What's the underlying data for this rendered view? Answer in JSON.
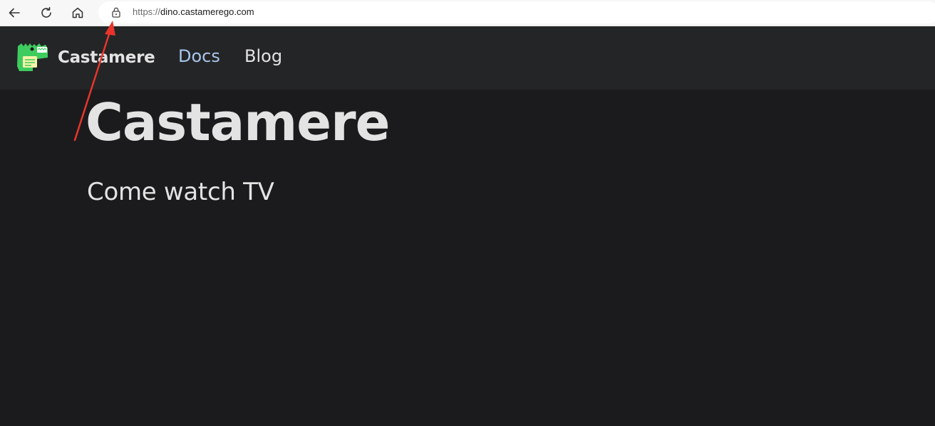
{
  "browser": {
    "url_scheme": "https://",
    "url_host": "dino.castamerego.com",
    "icons": [
      "back-arrow-icon",
      "reload-icon",
      "home-icon",
      "lock-icon"
    ]
  },
  "navbar": {
    "brand_title": "Castamere",
    "brand_logo_icon": "dinosaur-logo-icon",
    "links": [
      {
        "label": "Docs",
        "color": "#a9c6ee"
      },
      {
        "label": "Blog",
        "color": "#e3e3e3"
      }
    ]
  },
  "hero": {
    "title": "Castamere",
    "subtitle": "Come watch TV"
  },
  "colors": {
    "page_background": "#1b1b1d",
    "navbar_background": "#242526",
    "text": "#e3e3e3",
    "annotation_arrow": "#e8352c",
    "logo_green": "#3ecc5f"
  }
}
